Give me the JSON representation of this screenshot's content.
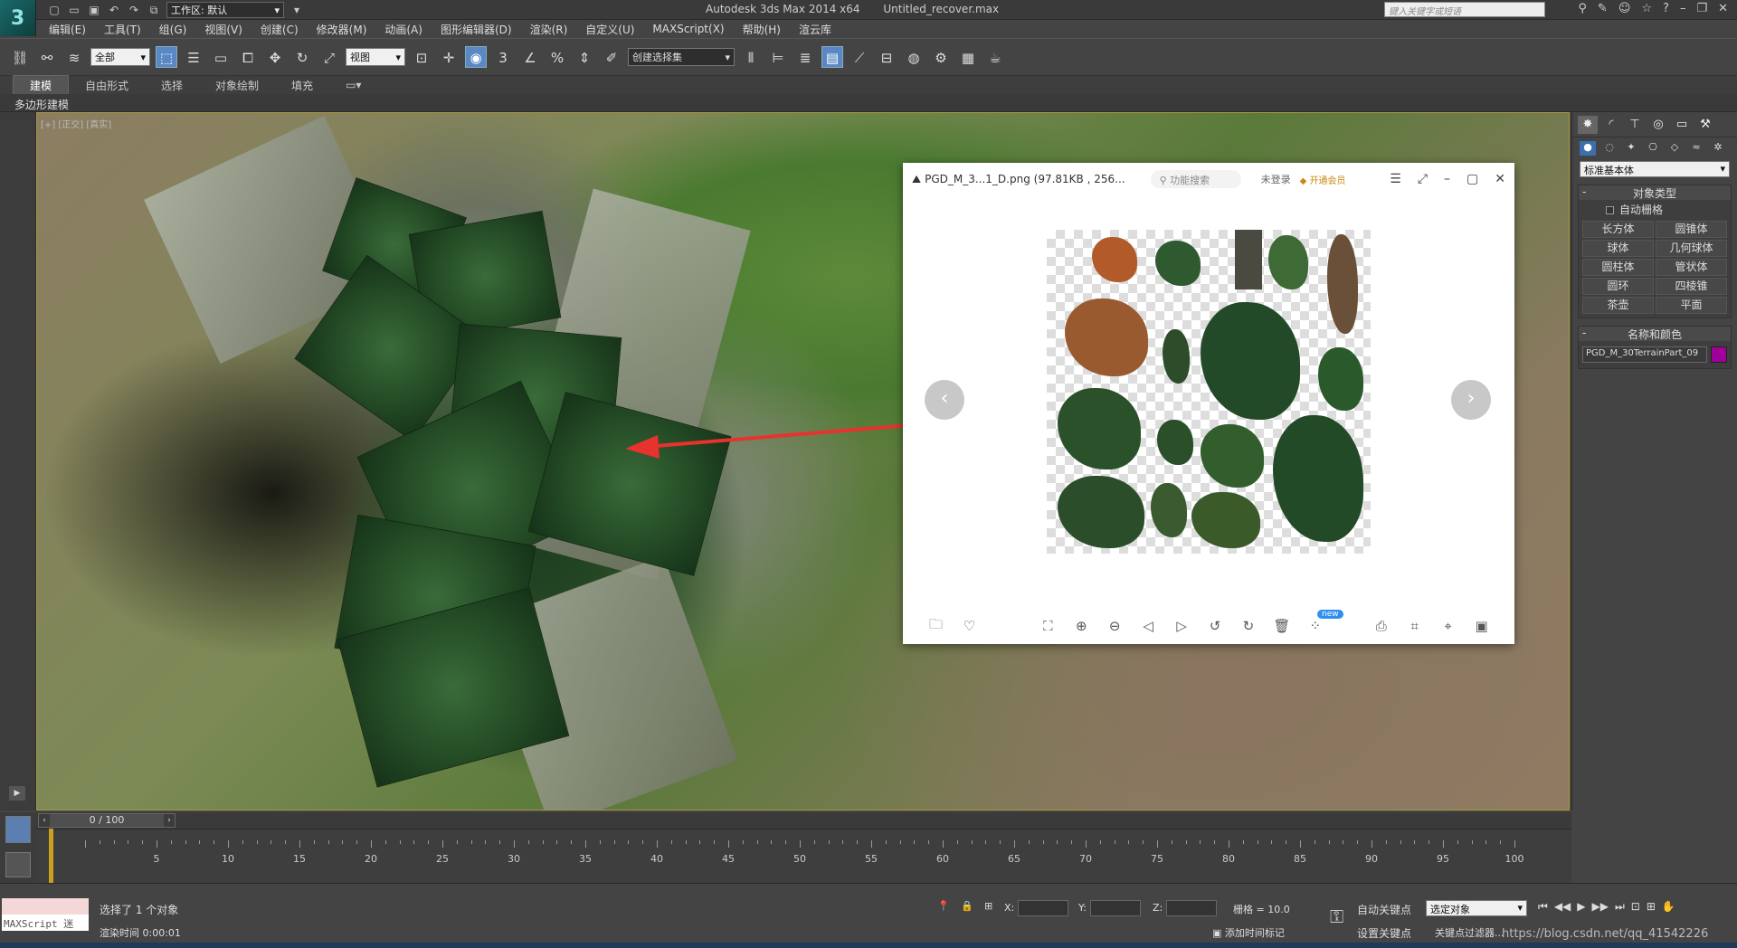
{
  "app": {
    "logo_text": "3",
    "window_title": "Autodesk 3ds Max  2014 x64",
    "file_title": "Untitled_recover.max",
    "workspace": "工作区: 默认",
    "search_placeholder": "键入关键字或短语"
  },
  "menu": [
    "编辑(E)",
    "工具(T)",
    "组(G)",
    "视图(V)",
    "创建(C)",
    "修改器(M)",
    "动画(A)",
    "图形编辑器(D)",
    "渲染(R)",
    "自定义(U)",
    "MAXScript(X)",
    "帮助(H)",
    "渲云库"
  ],
  "toolbar": {
    "selection_filter": "全部",
    "ref_coord": "视图",
    "named_selection": "创建选择集",
    "snap_label": "3"
  },
  "ribbon": {
    "tabs": [
      "建模",
      "自由形式",
      "选择",
      "对象绘制",
      "填充"
    ],
    "sub_label": "多边形建模"
  },
  "viewport": {
    "label": "[+] [正交] [真实]"
  },
  "viewer": {
    "title": "PGD_M_3...1_D.png (97.81KB , 256...",
    "search": "功能搜索",
    "login": "未登录",
    "vip": "开通会员",
    "badge": "new",
    "prev": "‹",
    "next": "›"
  },
  "command_panel": {
    "dropdown": "标准基本体",
    "object_type_title": "对象类型",
    "autogrid": "自动栅格",
    "buttons": [
      "长方体",
      "圆锥体",
      "球体",
      "几何球体",
      "圆柱体",
      "管状体",
      "圆环",
      "四棱锥",
      "茶壶",
      "平面"
    ],
    "name_color_title": "名称和颜色",
    "object_name": "PGD_M_30TerrainPart_09",
    "object_color": "#a0009a"
  },
  "timeline": {
    "position": "0 / 100",
    "ticks": [
      0,
      5,
      10,
      15,
      20,
      25,
      30,
      35,
      40,
      45,
      50,
      55,
      60,
      65,
      70,
      75,
      80,
      85,
      90,
      95,
      100
    ]
  },
  "status": {
    "maxscript": "MAXScript 迷",
    "selected": "选择了 1 个对象",
    "render_time": "渲染时间  0:00:01",
    "x_label": "X:",
    "y_label": "Y:",
    "z_label": "Z:",
    "grid": "栅格 = 10.0",
    "add_time_tag": "添加时间标记",
    "auto_key": "自动关键点",
    "set_key": "设置关键点",
    "key_mode": "选定对象",
    "key_filter": "关键点过滤器...",
    "watermark": "https://blog.csdn.net/qq_41542226"
  }
}
